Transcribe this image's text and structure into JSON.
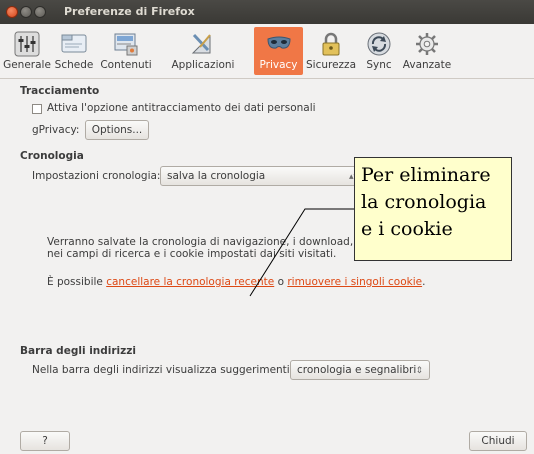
{
  "window": {
    "title": "Preferenze di Firefox"
  },
  "toolbar": {
    "tabs": [
      {
        "label": "Generale",
        "icon": "switches-icon"
      },
      {
        "label": "Schede",
        "icon": "tabs-icon"
      },
      {
        "label": "Contenuti",
        "icon": "content-icon"
      },
      {
        "label": "Applicazioni",
        "icon": "applications-icon"
      },
      {
        "label": "Privacy",
        "icon": "mask-icon",
        "active": true
      },
      {
        "label": "Sicurezza",
        "icon": "lock-icon"
      },
      {
        "label": "Sync",
        "icon": "sync-icon"
      },
      {
        "label": "Avanzate",
        "icon": "gear-icon"
      }
    ]
  },
  "tracking": {
    "heading": "Tracciamento",
    "checkbox_label": "Attiva l'opzione antitracciamento dei dati personali",
    "gprivacy_label": "gPrivacy:",
    "options_button": "Options..."
  },
  "history": {
    "heading": "Cronologia",
    "settings_label": "Impostazioni cronologia:",
    "settings_value": "salva la cronologia",
    "desc_line1": "Verranno salvate la cronologia di navigazione, i download, le info",
    "desc_line2": "nei campi di ricerca e i cookie impostati dai siti visitati.",
    "possible_text": "È possibile ",
    "clear_link": "cancellare la cronologia recente",
    "or_text": " o ",
    "remove_link": "rimuovere i singoli cookie",
    "end_text": "."
  },
  "addressbar": {
    "heading": "Barra degli indirizzi",
    "label": "Nella barra degli indirizzi visualizza suggerimenti da:",
    "value": "cronologia e segnalibri"
  },
  "footer": {
    "help_button": "?",
    "close_button": "Chiudi"
  },
  "callout": {
    "lines": [
      "Per eliminare",
      "la cronologia",
      "e i cookie"
    ]
  },
  "colors": {
    "accent": "#f07746",
    "link": "#dd4814",
    "callout_bg": "#ffffcc"
  }
}
